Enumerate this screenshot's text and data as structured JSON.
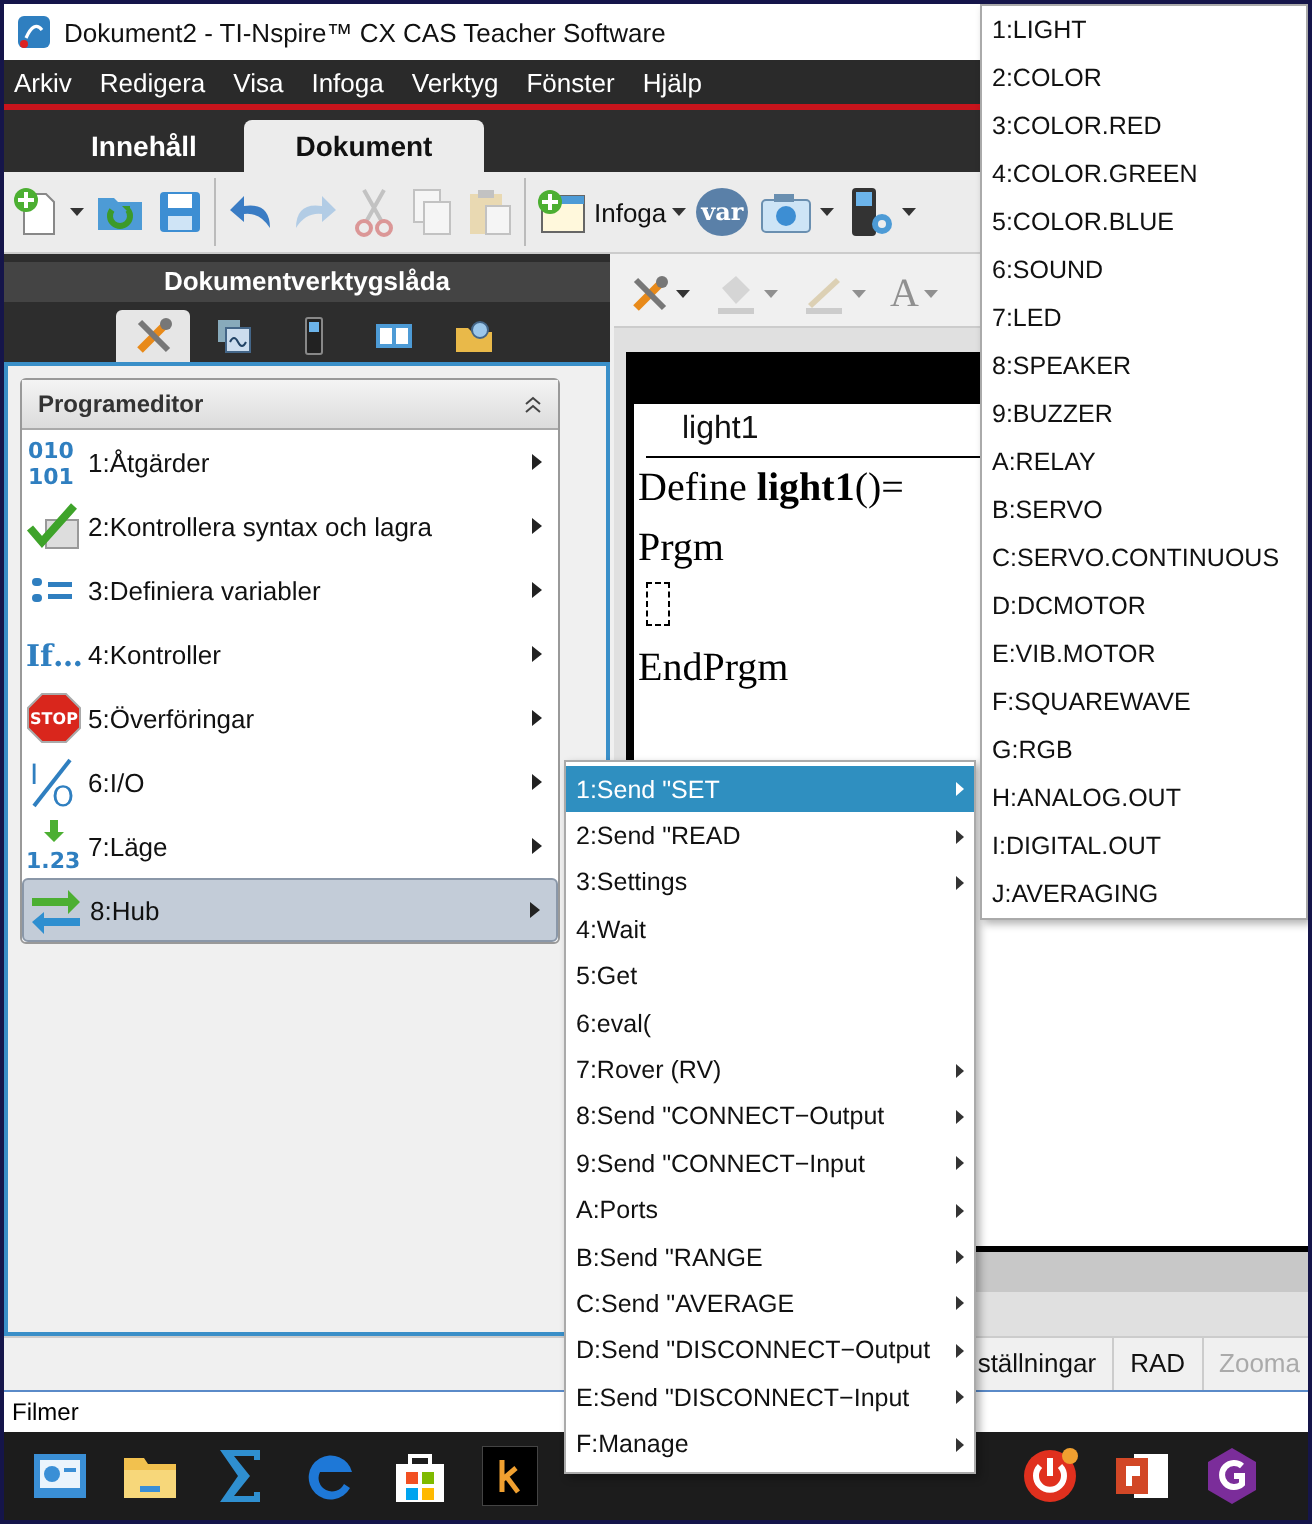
{
  "window": {
    "title": "Dokument2 - TI-Nspire™ CX CAS Teacher Software"
  },
  "menu_bar": [
    "Arkiv",
    "Redigera",
    "Visa",
    "Infoga",
    "Verktyg",
    "Fönster",
    "Hjälp"
  ],
  "tabs": [
    {
      "label": "Innehåll",
      "selected": false
    },
    {
      "label": "Dokument",
      "selected": true
    }
  ],
  "toolbar": [
    {
      "kind": "new",
      "dropdown": true,
      "disabled": false
    },
    {
      "kind": "open",
      "dropdown": false,
      "disabled": false
    },
    {
      "kind": "save",
      "dropdown": false,
      "disabled": false
    },
    {
      "kind": "separator"
    },
    {
      "kind": "undo",
      "dropdown": false,
      "disabled": false
    },
    {
      "kind": "redo",
      "dropdown": false,
      "disabled": true
    },
    {
      "kind": "cut",
      "dropdown": false,
      "disabled": true
    },
    {
      "kind": "copy",
      "dropdown": false,
      "disabled": true
    },
    {
      "kind": "paste",
      "dropdown": false,
      "disabled": true
    },
    {
      "kind": "separator"
    },
    {
      "kind": "insert",
      "label": "Infoga",
      "dropdown": true,
      "disabled": false
    },
    {
      "kind": "variable",
      "label": "var",
      "dropdown": false,
      "disabled": false
    },
    {
      "kind": "camera",
      "dropdown": true,
      "disabled": false
    },
    {
      "kind": "device",
      "dropdown": true,
      "disabled": false
    }
  ],
  "toolbox": {
    "title": "Dokumentverktygslåda",
    "tabs": [
      {
        "kind": "tools",
        "selected": true
      },
      {
        "kind": "graph",
        "selected": false
      },
      {
        "kind": "handheld",
        "selected": false
      },
      {
        "kind": "book",
        "selected": false
      },
      {
        "kind": "folder",
        "selected": false
      }
    ]
  },
  "program_editor": {
    "title": "Programeditor",
    "items": [
      {
        "kind": "binary",
        "icon_text": [
          "010",
          "101"
        ],
        "label": "1:Åtgärder",
        "selected": false
      },
      {
        "kind": "check",
        "label": "2:Kontrollera syntax och lagra",
        "selected": false
      },
      {
        "kind": "define",
        "label": "3:Definiera variabler",
        "selected": false
      },
      {
        "kind": "if",
        "icon_text": [
          "If…"
        ],
        "label": "4:Kontroller",
        "selected": false
      },
      {
        "kind": "stop",
        "icon_text": [
          "STOP"
        ],
        "label": "5:Överföringar",
        "selected": false
      },
      {
        "kind": "io",
        "icon_text": [
          "I",
          "O"
        ],
        "label": "6:I/O",
        "selected": false
      },
      {
        "kind": "mode",
        "icon_text": [
          "1.23"
        ],
        "label": "7:Läge",
        "selected": false
      },
      {
        "kind": "hub",
        "label": "8:Hub",
        "selected": true
      }
    ]
  },
  "doc_toolbar": [
    {
      "kind": "tools",
      "disabled": false
    },
    {
      "kind": "fill",
      "disabled": true
    },
    {
      "kind": "line",
      "disabled": true
    },
    {
      "kind": "text_color",
      "label": "A",
      "disabled": true
    }
  ],
  "editor": {
    "tab": "light1",
    "lines": [
      {
        "kind": "text",
        "text": "Define **light1**()="
      },
      {
        "kind": "text",
        "text": "Prgm"
      },
      {
        "kind": "placeholder"
      },
      {
        "kind": "text",
        "text": "EndPrgm"
      }
    ]
  },
  "hub_menu": [
    {
      "label": "1:Send \"SET",
      "submenu": true,
      "selected": true
    },
    {
      "label": "2:Send \"READ",
      "submenu": true,
      "selected": false
    },
    {
      "label": "3:Settings",
      "submenu": true,
      "selected": false
    },
    {
      "label": "4:Wait",
      "submenu": false,
      "selected": false
    },
    {
      "label": "5:Get",
      "submenu": false,
      "selected": false
    },
    {
      "label": "6:eval(",
      "submenu": false,
      "selected": false
    },
    {
      "label": "7:Rover (RV)",
      "submenu": true,
      "selected": false
    },
    {
      "label": "8:Send \"CONNECT−Output",
      "submenu": true,
      "selected": false
    },
    {
      "label": "9:Send \"CONNECT−Input",
      "submenu": true,
      "selected": false
    },
    {
      "label": "A:Ports",
      "submenu": true,
      "selected": false
    },
    {
      "label": "B:Send \"RANGE",
      "submenu": true,
      "selected": false
    },
    {
      "label": "C:Send \"AVERAGE",
      "submenu": true,
      "selected": false
    },
    {
      "label": "D:Send \"DISCONNECT−Output",
      "submenu": true,
      "selected": false
    },
    {
      "label": "E:Send \"DISCONNECT−Input",
      "submenu": true,
      "selected": false
    },
    {
      "label": "F:Manage",
      "submenu": true,
      "selected": false
    }
  ],
  "set_menu": [
    "1:LIGHT",
    "2:COLOR",
    "3:COLOR.RED",
    "4:COLOR.GREEN",
    "5:COLOR.BLUE",
    "6:SOUND",
    "7:LED",
    "8:SPEAKER",
    "9:BUZZER",
    "A:RELAY",
    "B:SERVO",
    "C:SERVO.CONTINUOUS",
    "D:DCMOTOR",
    "E:VIB.MOTOR",
    "F:SQUAREWAVE",
    "G:RGB",
    "H:ANALOG.OUT",
    "I:DIGITAL.OUT",
    "J:AVERAGING"
  ],
  "status_bar": [
    {
      "label": "ställningar",
      "disabled": false
    },
    {
      "label": "RAD",
      "disabled": false
    },
    {
      "label": "Zooma",
      "disabled": true
    }
  ],
  "footer": "Filmer",
  "taskbar": [
    {
      "kind": "presentation"
    },
    {
      "kind": "explorer"
    },
    {
      "kind": "sigma"
    },
    {
      "kind": "edge"
    },
    {
      "kind": "store"
    },
    {
      "kind": "kindle"
    },
    {
      "kind": "gap"
    },
    {
      "kind": "power"
    },
    {
      "kind": "powerpoint"
    },
    {
      "kind": "pdf"
    }
  ]
}
